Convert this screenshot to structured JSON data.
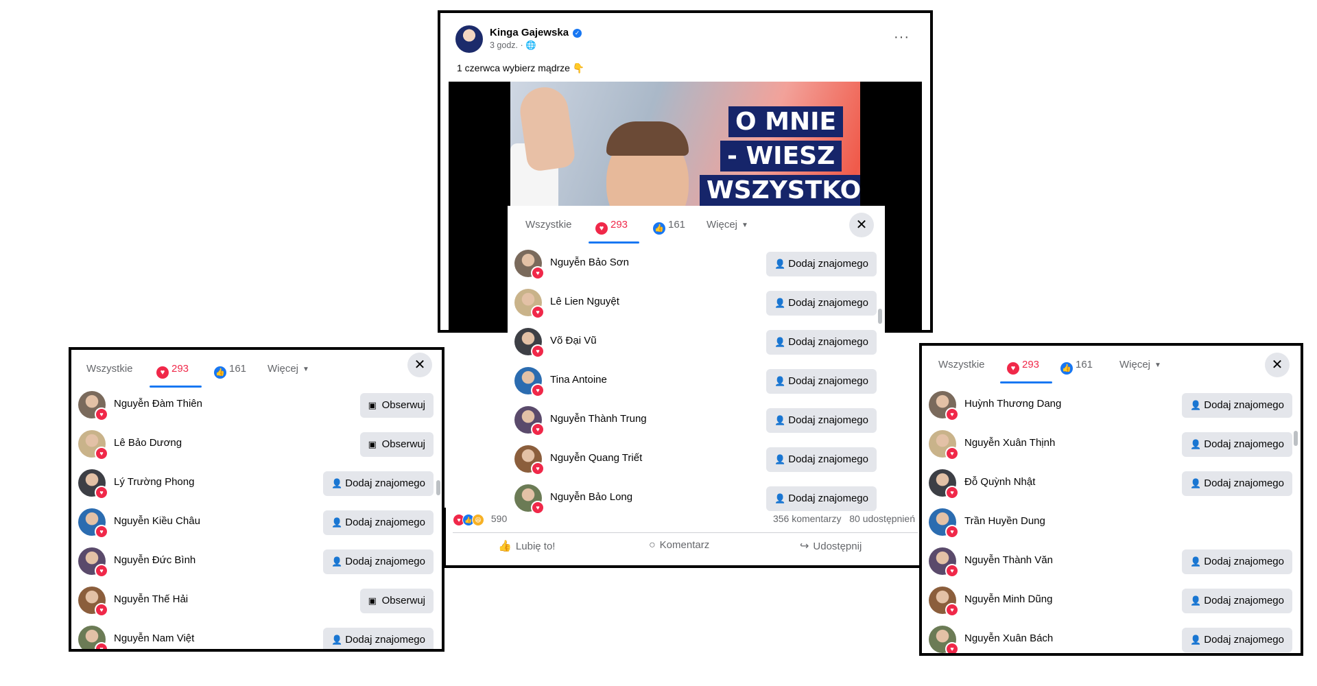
{
  "post": {
    "author": "Kinga Gajewska",
    "meta": "3 godz. · 🌐",
    "more": "···",
    "text": "1 czerwca wybierz mądrze 👇",
    "image_text": [
      "O MNIE",
      "- WIESZ",
      "WSZYSTKO"
    ],
    "reactions_count": "590",
    "comments": "356 komentarzy",
    "shares": "80 udostępnień",
    "actions": {
      "like": "Lubię to!",
      "comment": "Komentarz",
      "share": "Udostępnij"
    }
  },
  "modal_tabs": {
    "all": "Wszystkie",
    "love": "293",
    "like": "161",
    "more": "Więcej",
    "close": "✕"
  },
  "center_list": [
    {
      "name": "Nguyễn Bảo Sơn",
      "action": "Dodaj znajomego"
    },
    {
      "name": "Lê Lien Nguyệt",
      "action": "Dodaj znajomego"
    },
    {
      "name": "Võ Đại Vũ",
      "action": "Dodaj znajomego"
    },
    {
      "name": "Tina Antoine",
      "action": "Dodaj znajomego"
    },
    {
      "name": "Nguyễn Thành Trung",
      "action": "Dodaj znajomego"
    },
    {
      "name": "Nguyễn Quang Triết",
      "action": "Dodaj znajomego"
    },
    {
      "name": "Nguyễn Bảo Long",
      "action": "Dodaj znajomego"
    }
  ],
  "left_list": [
    {
      "name": "Nguyễn Đàm Thiên",
      "action": "Obserwuj"
    },
    {
      "name": "Lê Bảo Dương",
      "action": "Obserwuj"
    },
    {
      "name": "Lý Trường Phong",
      "action": "Dodaj znajomego"
    },
    {
      "name": "Nguyễn Kiều Châu",
      "action": "Dodaj znajomego"
    },
    {
      "name": "Nguyễn Đức Bình",
      "action": "Dodaj znajomego"
    },
    {
      "name": "Nguyễn Thế Hải",
      "action": "Obserwuj"
    },
    {
      "name": "Nguyễn Nam Việt",
      "action": "Dodaj znajomego"
    }
  ],
  "right_list": [
    {
      "name": "Huỳnh Thương Dang",
      "action": "Dodaj znajomego"
    },
    {
      "name": "Nguyễn Xuân Thịnh",
      "action": "Dodaj znajomego"
    },
    {
      "name": "Đỗ Quỳnh Nhật",
      "action": "Dodaj znajomego"
    },
    {
      "name": "Trần Huyền Dung",
      "action": ""
    },
    {
      "name": "Nguyễn Thành Văn",
      "action": "Dodaj znajomego"
    },
    {
      "name": "Nguyễn Minh Dũng",
      "action": "Dodaj znajomego"
    },
    {
      "name": "Nguyễn Xuân Bách",
      "action": "Dodaj znajomego"
    }
  ],
  "icons": {
    "add_friend": "add-friend-icon",
    "follow": "follow-icon",
    "love": "love-reaction-icon",
    "like": "like-reaction-icon"
  },
  "colors": {
    "love": "#f02849",
    "like": "#1877f2",
    "button_bg": "#e4e6eb",
    "muted": "#65676b"
  }
}
